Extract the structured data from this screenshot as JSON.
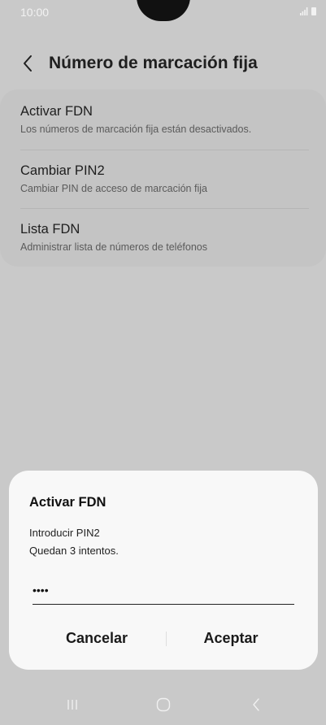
{
  "status_bar": {
    "time": "10:00"
  },
  "header": {
    "title": "Número de marcación fija"
  },
  "settings": {
    "items": [
      {
        "title": "Activar FDN",
        "subtitle": "Los números de marcación fija están desactivados."
      },
      {
        "title": "Cambiar PIN2",
        "subtitle": "Cambiar PIN de acceso de marcación fija"
      },
      {
        "title": "Lista FDN",
        "subtitle": "Administrar lista de números de teléfonos"
      }
    ]
  },
  "dialog": {
    "title": "Activar FDN",
    "message_line1": "Introducir PIN2",
    "message_line2": "Quedan 3 intentos.",
    "pin_value": "1234",
    "cancel_label": "Cancelar",
    "accept_label": "Aceptar"
  },
  "colors": {
    "dialog_bg": "#f8f8f8",
    "overlay_bg": "#c9c9c9"
  },
  "icons": {
    "back": "chevron-left-icon",
    "recents": "recents-icon",
    "home": "home-icon",
    "nav_back": "back-icon"
  }
}
